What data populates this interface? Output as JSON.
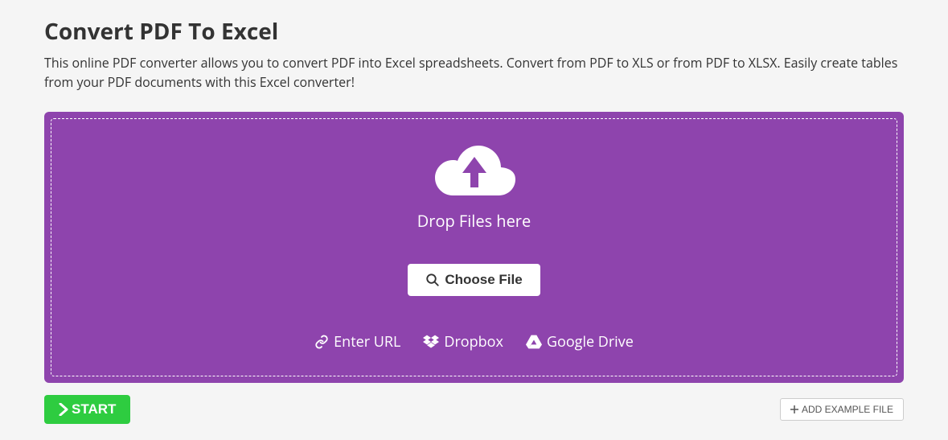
{
  "header": {
    "title": "Convert PDF To Excel",
    "description": "This online PDF converter allows you to convert PDF into Excel spreadsheets. Convert from PDF to XLS or from PDF to XLSX. Easily create tables from your PDF documents with this Excel converter!"
  },
  "dropzone": {
    "drop_label": "Drop Files here",
    "choose_file": "Choose File",
    "sources": {
      "enter_url": "Enter URL",
      "dropbox": "Dropbox",
      "google_drive": "Google Drive"
    }
  },
  "actions": {
    "start": "START",
    "add_example": "ADD EXAMPLE FILE"
  },
  "colors": {
    "accent": "#8E44AD",
    "start_green": "#2ECC40"
  }
}
